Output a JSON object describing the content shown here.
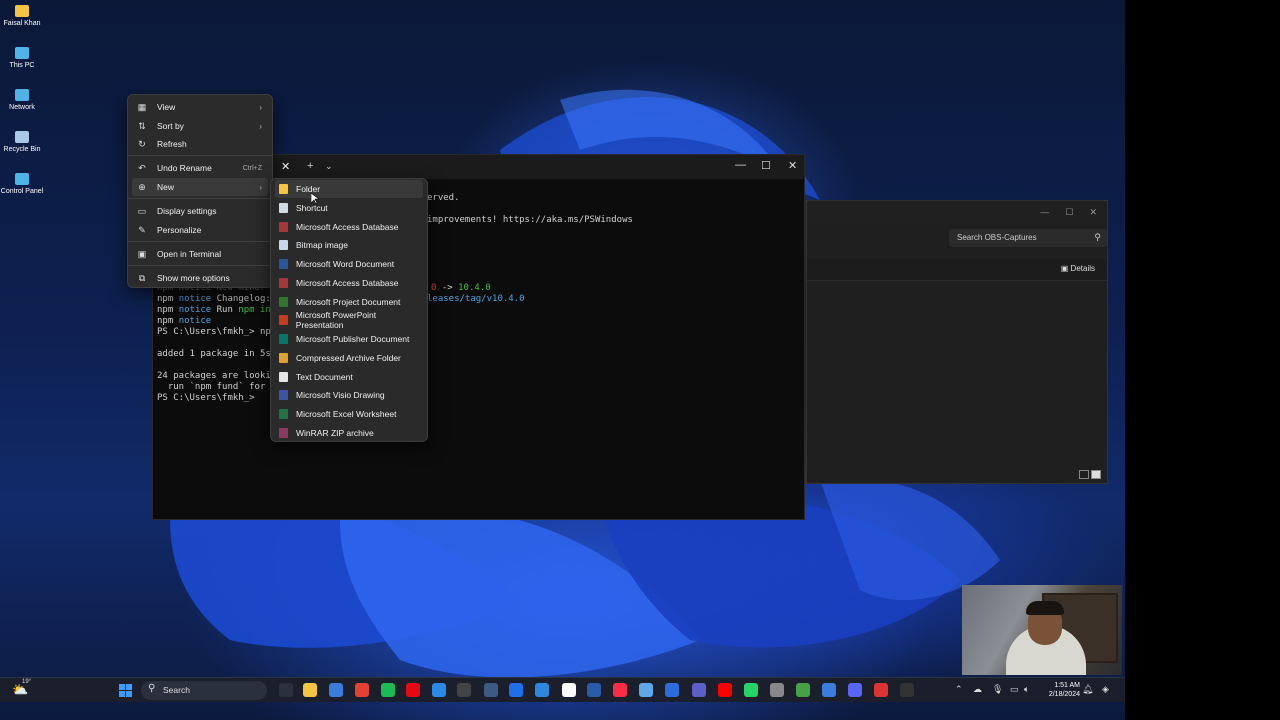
{
  "desktop_icons": [
    {
      "label": "Faisal Khan",
      "icon": "folder-icon",
      "color": "#f5c542"
    },
    {
      "label": "This PC",
      "icon": "computer-icon",
      "color": "#4fb3e8"
    },
    {
      "label": "Network",
      "icon": "network-icon",
      "color": "#4fb3e8"
    },
    {
      "label": "Recycle Bin",
      "icon": "recycle-bin-icon",
      "color": "#a9c8e8"
    },
    {
      "label": "Control Panel",
      "icon": "control-panel-icon",
      "color": "#4fb3e8"
    }
  ],
  "context_menu": {
    "items": [
      {
        "label": "View",
        "icon": "view-grid-icon",
        "glyph": "▦",
        "submenu": true
      },
      {
        "label": "Sort by",
        "icon": "sort-icon",
        "glyph": "⇅",
        "submenu": true
      },
      {
        "label": "Refresh",
        "icon": "refresh-icon",
        "glyph": "↻"
      },
      {
        "label": "Undo Rename",
        "icon": "undo-icon",
        "glyph": "↶",
        "shortcut": "Ctrl+Z"
      },
      {
        "label": "New",
        "icon": "new-icon",
        "glyph": "⊕",
        "submenu": true
      },
      {
        "label": "Display settings",
        "icon": "display-icon",
        "glyph": "▭"
      },
      {
        "label": "Personalize",
        "icon": "brush-icon",
        "glyph": "✎"
      },
      {
        "label": "Open in Terminal",
        "icon": "terminal-icon",
        "glyph": "▣"
      },
      {
        "label": "Show more options",
        "icon": "more-options-icon",
        "glyph": "⧉"
      }
    ]
  },
  "new_submenu": {
    "items": [
      {
        "label": "Folder",
        "icon": "folder-icon",
        "color": "#f5c542"
      },
      {
        "label": "Shortcut",
        "icon": "shortcut-icon",
        "color": "#cfd8e3"
      },
      {
        "label": "Microsoft Access Database",
        "icon": "access-icon",
        "color": "#a4373a"
      },
      {
        "label": "Bitmap image",
        "icon": "bitmap-icon",
        "color": "#c9d6e6"
      },
      {
        "label": "Microsoft Word Document",
        "icon": "word-icon",
        "color": "#2b579a"
      },
      {
        "label": "Microsoft Access Database",
        "icon": "access-icon",
        "color": "#a4373a"
      },
      {
        "label": "Microsoft Project Document",
        "icon": "project-icon",
        "color": "#31752f"
      },
      {
        "label": "Microsoft PowerPoint Presentation",
        "icon": "powerpoint-icon",
        "color": "#c43e1c"
      },
      {
        "label": "Microsoft Publisher Document",
        "icon": "publisher-icon",
        "color": "#077568"
      },
      {
        "label": "Compressed Archive Folder",
        "icon": "archive-folder-icon",
        "color": "#e0a030"
      },
      {
        "label": "Text Document",
        "icon": "text-document-icon",
        "color": "#e6e6e6"
      },
      {
        "label": "Microsoft Visio Drawing",
        "icon": "visio-icon",
        "color": "#3955a3"
      },
      {
        "label": "Microsoft Excel Worksheet",
        "icon": "excel-icon",
        "color": "#217346"
      },
      {
        "label": "WinRAR ZIP archive",
        "icon": "winrar-icon",
        "color": "#8b3a62"
      }
    ]
  },
  "terminal": {
    "tab_close": "✕",
    "tab_add": "+",
    "tab_dropdown": "⌄",
    "minimize": "—",
    "maximize": "☐",
    "close": "✕",
    "line_reserved": "erved.",
    "line_improvements": "improvements! https://aka.ms/PSWindows",
    "line_version_prefix": "0",
    "line_version_arrow": " -> ",
    "line_version_new": "10.4.0",
    "line_release": "leases/tag/v10.4.0",
    "npm_hidden": "npm notice New minor",
    "npm": "npm",
    "notice": "notice",
    "changelog": " Changelog:",
    "run": " Run ",
    "run_cmd": "npm ins",
    "prompt1": "PS C:\\Users\\fmkh_> npm",
    "added": "added 1 package in 5s",
    "packages": "24 packages are lookin",
    "fund": "  run `npm fund` for d",
    "prompt2": "PS C:\\Users\\fmkh_>"
  },
  "explorer": {
    "minimize": "—",
    "maximize": "☐",
    "close": "✕",
    "search_placeholder": "Search OBS-Captures",
    "details_label": "Details"
  },
  "taskbar": {
    "weather_temp": "19°",
    "search_label": "Search",
    "time": "1:51 AM",
    "date": "2/18/2024"
  }
}
